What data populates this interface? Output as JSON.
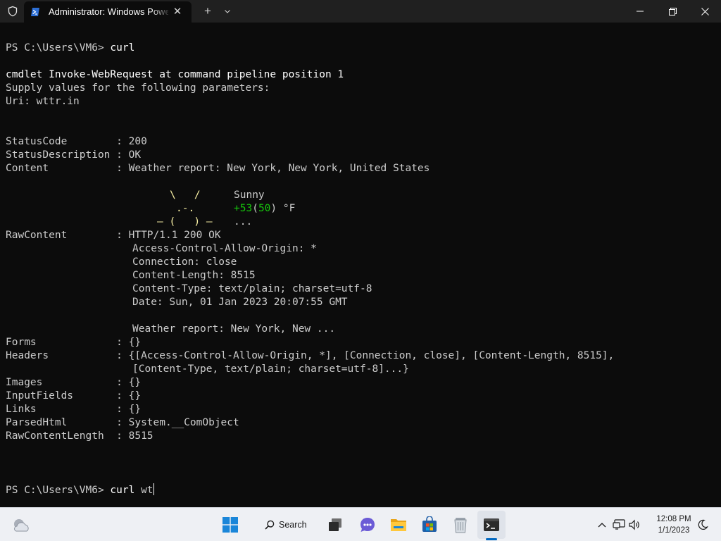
{
  "window": {
    "tab_title": "Administrator: Windows PowerShell",
    "close_tab_glyph": "✕",
    "new_tab_glyph": "+",
    "icons": {
      "shield": "shield-icon",
      "tab": "powershell-icon",
      "dropdown": "chevron-down-icon",
      "minimize": "minimize-icon",
      "maximize": "restore-icon",
      "close": "close-icon"
    }
  },
  "terminal": {
    "prompt": "PS C:\\Users\\VM6>",
    "first_command": "curl",
    "cmdlet_line": "cmdlet Invoke-WebRequest at command pipeline position 1",
    "supply_line": "Supply values for the following parameters:",
    "uri_label": "Uri:",
    "uri_value": "wttr.in",
    "status_code_label": "StatusCode        :",
    "status_code_value": "200",
    "status_desc_label": "StatusDescription :",
    "status_desc_value": "OK",
    "content_label": "Content           :",
    "content_value": "Weather report: New York, New York, United States",
    "art_line_1": "\\   /",
    "art_line_2": ".-.",
    "art_line_3": "― (   ) ―",
    "weather_condition": "Sunny",
    "temp_open": "+53",
    "temp_paren_open": "(",
    "temp_feels": "50",
    "temp_paren_close": ")",
    "temp_unit": "°F",
    "weather_more": "...",
    "raw_label": "RawContent        :",
    "raw_http": "HTTP/1.1 200 OK",
    "raw_acao": "Access-Control-Allow-Origin: *",
    "raw_connection": "Connection: close",
    "raw_length": "Content-Length: 8515",
    "raw_type": "Content-Type: text/plain; charset=utf-8",
    "raw_date": "Date: Sun, 01 Jan 2023 20:07:55 GMT",
    "raw_report": "Weather report: New York, New ...",
    "forms_label": "Forms             :",
    "forms_value": "{}",
    "headers_label": "Headers           :",
    "headers_value_1": "{[Access-Control-Allow-Origin, *], [Connection, close], [Content-Length, 8515],",
    "headers_value_2": "[Content-Type, text/plain; charset=utf-8]...}",
    "images_label": "Images            :",
    "images_value": "{}",
    "inputfields_label": "InputFields       :",
    "inputfields_value": "{}",
    "links_label": "Links             :",
    "links_value": "{}",
    "parsedhtml_label": "ParsedHtml        :",
    "parsedhtml_value": "System.__ComObject",
    "rawlength_label": "RawContentLength  :",
    "rawlength_value": "8515",
    "current_command": "curl",
    "current_input": "wt"
  },
  "taskbar": {
    "search_label": "Search",
    "time": "12:08 PM",
    "date": "1/1/2023",
    "accent": "#0067c0",
    "icons": [
      "weather-widget-icon",
      "windows-start-icon",
      "search-icon",
      "task-view-icon",
      "teams-chat-icon",
      "file-explorer-icon",
      "microsoft-store-icon",
      "recycle-bin-icon",
      "terminal-icon",
      "chevron-up-icon",
      "network-icon",
      "volume-icon",
      "do-not-disturb-icon"
    ]
  }
}
